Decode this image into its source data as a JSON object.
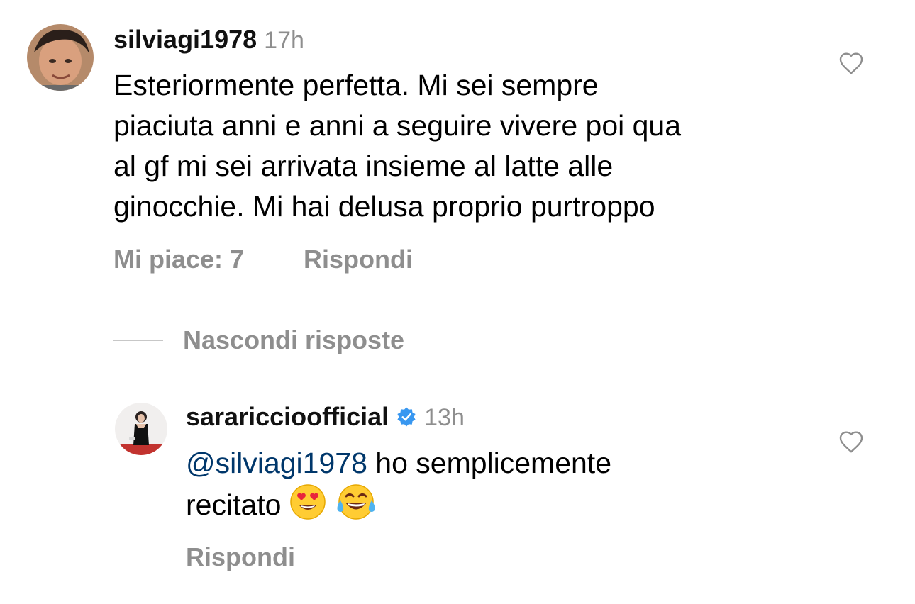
{
  "comment": {
    "username": "silviagi1978",
    "time": "17h",
    "text_lines": [
      "Esteriormente perfetta. Mi sei sempre",
      "piaciuta anni e anni a seguire vivere poi qua",
      "al gf mi sei arrivata insieme al latte alle",
      "ginocchie. Mi hai delusa proprio purtroppo"
    ],
    "likes_label": "Mi piace: 7",
    "reply_label": "Rispondi",
    "like_icon": "heart-outline-icon"
  },
  "replies_toggle": {
    "label": "Nascondi risposte"
  },
  "reply": {
    "username": "sarariccioofficial",
    "verified_icon": "verified-badge-icon",
    "time": "13h",
    "mention": "@silviagi1978",
    "text_line1": " ho semplicemente",
    "text_line2": "recitato",
    "emojis": [
      "heart-eyes-emoji",
      "tears-of-joy-emoji"
    ],
    "reply_label": "Rispondi",
    "like_icon": "heart-outline-icon"
  },
  "colors": {
    "secondary_text": "#8e8e8e",
    "mention": "#00376b",
    "verified": "#3897f0"
  }
}
